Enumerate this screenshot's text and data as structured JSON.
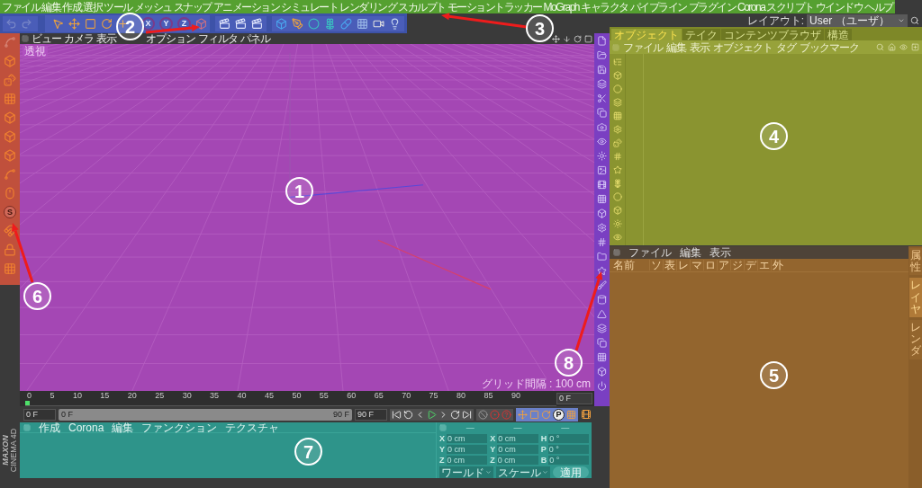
{
  "menu_bar": {
    "items": [
      "ファイル",
      "編集",
      "作成",
      "選択",
      "ツール",
      "メッシュ",
      "スナップ",
      "アニメーション",
      "シミュレート",
      "レンダリング",
      "スカルプト",
      "モーショントラッカー",
      "MoGraph",
      "キャラクタ",
      "パイプライン",
      "プラグイン",
      "Corona",
      "スクリプト",
      "ウインドウ",
      "ヘルプ"
    ],
    "layout_label": "レイアウト:",
    "layout_value": "User （ユーザ）"
  },
  "toolbar": {
    "axis_buttons": [
      "X",
      "Y",
      "Z"
    ]
  },
  "left_toolbar": {
    "snap_label": "S"
  },
  "viewport": {
    "menu": [
      "ビュー",
      "カメラ",
      "表示",
      "オプション",
      "フィルタ",
      "パネル"
    ],
    "view_name": "透視",
    "grid_info": "グリッド間隔 : 100 cm"
  },
  "object_manager": {
    "tabs": [
      {
        "label": "オブジェクト",
        "selected": true
      },
      {
        "label": "テイク",
        "selected": false
      },
      {
        "label": "コンテンツブラウザ",
        "selected": false
      },
      {
        "label": "構造",
        "selected": false
      }
    ],
    "menu": [
      "ファイル",
      "編集",
      "表示",
      "オブジェクト",
      "タグ",
      "ブックマーク"
    ]
  },
  "layer_manager": {
    "menu": [
      "ファイル",
      "編集",
      "表示"
    ],
    "columns": [
      "名前",
      "ソ",
      "表",
      "レ",
      "マ",
      "ロ",
      "ア",
      "ジ",
      "デ",
      "エ",
      "外"
    ],
    "side_tabs": [
      {
        "label": "属性",
        "selected": false
      },
      {
        "label": "レイヤ",
        "selected": true
      },
      {
        "label": "レンダ",
        "selected": false
      }
    ]
  },
  "timeline": {
    "ticks": [
      "0",
      "5",
      "10",
      "15",
      "20",
      "25",
      "30",
      "35",
      "40",
      "45",
      "50",
      "55",
      "60",
      "65",
      "70",
      "75",
      "80",
      "85",
      "90"
    ],
    "frame_field": "0 F"
  },
  "transport": {
    "level": 1,
    "start_field": "0 F",
    "range_start": "0 F",
    "range_end": "90 F",
    "end_field": "90 F",
    "key_label": "P"
  },
  "material_manager": {
    "menu": [
      "作成",
      "Corona",
      "編集",
      "ファンクション",
      "テクスチャ"
    ]
  },
  "coordinates": {
    "headers": [
      "—",
      "—",
      "—"
    ],
    "rows": [
      {
        "a": "X",
        "v": "0 cm",
        "b": "X",
        "w": "0 cm",
        "c": "H",
        "u": "0 °"
      },
      {
        "a": "Y",
        "v": "0 cm",
        "b": "Y",
        "w": "0 cm",
        "c": "P",
        "u": "0 °"
      },
      {
        "a": "Z",
        "v": "0 cm",
        "b": "Z",
        "w": "0 cm",
        "c": "B",
        "u": "0 °"
      }
    ],
    "dropdowns": [
      "ワールド",
      "スケール"
    ],
    "apply_button": "適用"
  },
  "logo": {
    "brand": "MAXON",
    "product": "CINEMA 4D"
  },
  "callouts": [
    {
      "number": "1"
    },
    {
      "number": "2"
    },
    {
      "number": "3"
    },
    {
      "number": "4"
    },
    {
      "number": "5"
    },
    {
      "number": "6"
    },
    {
      "number": "7"
    },
    {
      "number": "8"
    }
  ]
}
